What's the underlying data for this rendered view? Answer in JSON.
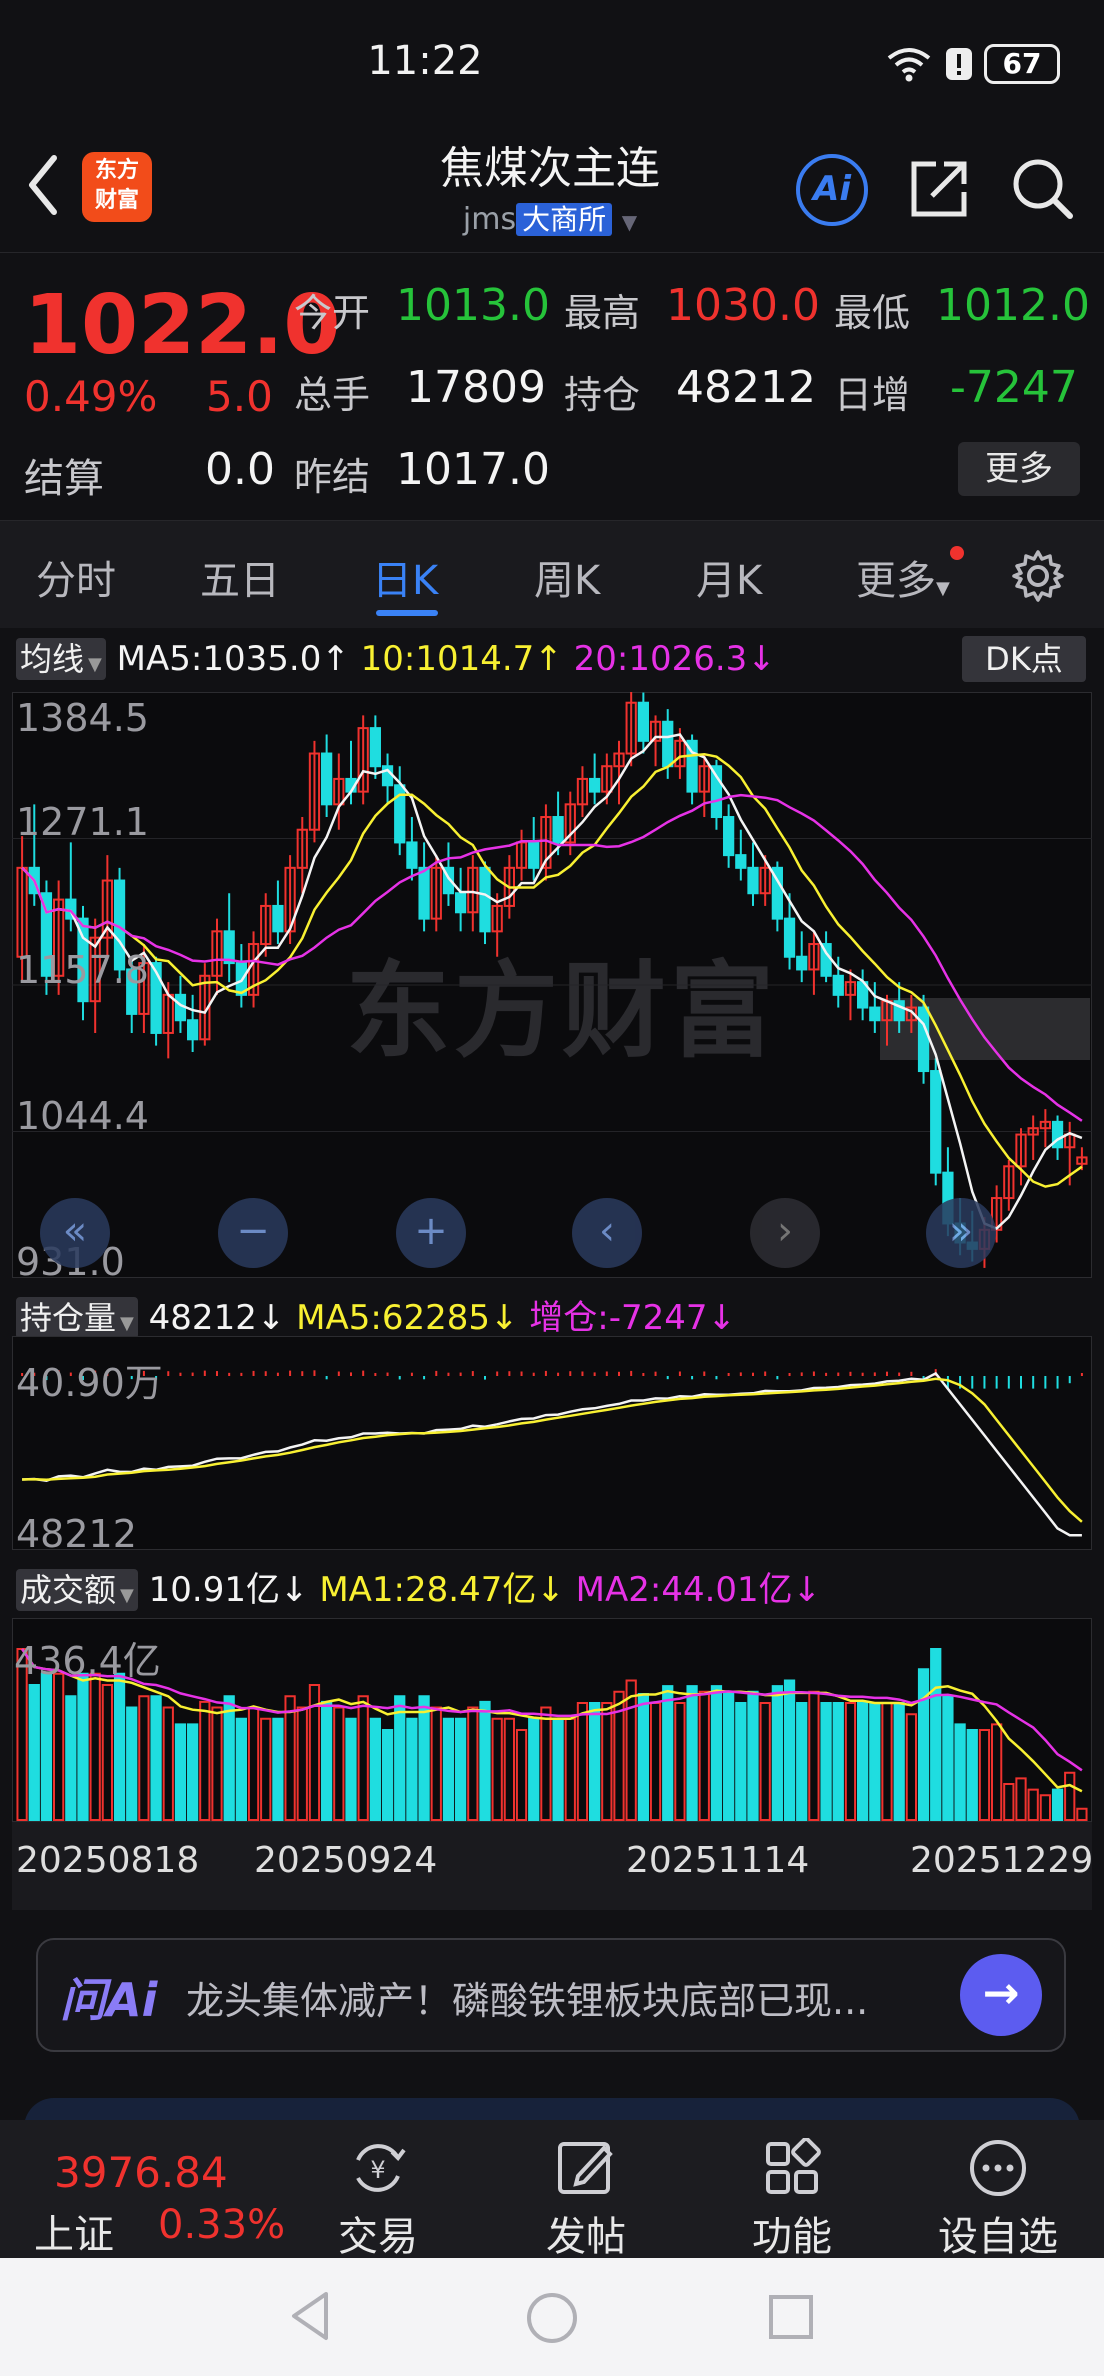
{
  "status": {
    "time": "11:22",
    "battery": "67"
  },
  "header": {
    "logo_line1": "东方",
    "logo_line2": "财富",
    "title": "焦煤次主连",
    "symbol": "jms",
    "exchange": "大商所"
  },
  "quote": {
    "price": "1022.0",
    "change_pct": "0.49%",
    "change": "5.0",
    "settle_label": "结算",
    "settle_value": "0.0",
    "fields": [
      {
        "label": "今开",
        "value": "1013.0",
        "color": "#26c33a"
      },
      {
        "label": "最高",
        "value": "1030.0",
        "color": "#f0322e"
      },
      {
        "label": "最低",
        "value": "1012.0",
        "color": "#26c33a"
      },
      {
        "label": "总手",
        "value": "17809",
        "color": "#f4f4f4"
      },
      {
        "label": "持仓",
        "value": "48212",
        "color": "#f4f4f4"
      },
      {
        "label": "日增",
        "value": "-7247",
        "color": "#26c33a"
      },
      {
        "label": "昨结",
        "value": "1017.0",
        "color": "#f4f4f4"
      }
    ],
    "more_label": "更多"
  },
  "tabs": [
    "分时",
    "五日",
    "日K",
    "周K",
    "月K",
    "更多"
  ],
  "kline": {
    "indicator_label": "均线",
    "ma5_text": "MA5:1035.0↑",
    "ma10_text": "10:1014.7↑",
    "ma20_text": "20:1026.3↓",
    "dk_label": "DK点",
    "watermark": "东方财富",
    "y_labels": [
      "1384.5",
      "1271.1",
      "1157.8",
      "1044.4",
      "931.0"
    ]
  },
  "oi": {
    "indicator_label": "持仓量",
    "value_text": "48212↓",
    "ma5_text": "MA5:62285↓",
    "inc_text": "增仓:-7247↓",
    "y_top": "40.90万",
    "y_bottom": "48212"
  },
  "turnover": {
    "indicator_label": "成交额",
    "value_text": "10.91亿↓",
    "ma1_text": "MA1:28.47亿↓",
    "ma2_text": "MA2:44.01亿↓",
    "y_top": "436.4亿"
  },
  "x_labels": [
    "20250818",
    "20250924",
    "20251114",
    "20251229"
  ],
  "ai_prompt": {
    "logo": "问Ai",
    "text": "龙头集体减产！磷酸铁锂板块底部已现..."
  },
  "bottom_nav": {
    "index_value": "3976.84",
    "index_name": "上证",
    "index_pct": "0.33%",
    "items": [
      "交易",
      "发帖",
      "功能",
      "设自选"
    ]
  },
  "colors": {
    "up": "#f0322e",
    "down": "#1fdde0",
    "ma5": "#f4f4f4",
    "ma10": "#f8f032",
    "ma20": "#e632e6",
    "accent": "#3a82f6"
  },
  "chart_data": {
    "type": "candlestick",
    "price_range": [
      931.0,
      1384.5
    ],
    "ohlc": [
      [
        1180,
        1275,
        1160,
        1250
      ],
      [
        1250,
        1300,
        1220,
        1230
      ],
      [
        1230,
        1240,
        1150,
        1165
      ],
      [
        1165,
        1240,
        1150,
        1225
      ],
      [
        1225,
        1270,
        1200,
        1210
      ],
      [
        1210,
        1220,
        1130,
        1145
      ],
      [
        1145,
        1210,
        1120,
        1195
      ],
      [
        1195,
        1260,
        1180,
        1240
      ],
      [
        1240,
        1250,
        1160,
        1170
      ],
      [
        1170,
        1180,
        1120,
        1135
      ],
      [
        1135,
        1190,
        1120,
        1175
      ],
      [
        1175,
        1180,
        1110,
        1120
      ],
      [
        1120,
        1160,
        1100,
        1150
      ],
      [
        1150,
        1165,
        1120,
        1130
      ],
      [
        1130,
        1150,
        1105,
        1115
      ],
      [
        1115,
        1175,
        1110,
        1165
      ],
      [
        1165,
        1210,
        1150,
        1200
      ],
      [
        1200,
        1230,
        1160,
        1175
      ],
      [
        1175,
        1190,
        1140,
        1150
      ],
      [
        1150,
        1200,
        1140,
        1190
      ],
      [
        1190,
        1230,
        1180,
        1220
      ],
      [
        1220,
        1240,
        1190,
        1200
      ],
      [
        1200,
        1260,
        1190,
        1250
      ],
      [
        1250,
        1290,
        1230,
        1280
      ],
      [
        1280,
        1350,
        1270,
        1340
      ],
      [
        1340,
        1355,
        1290,
        1300
      ],
      [
        1300,
        1340,
        1280,
        1320
      ],
      [
        1320,
        1350,
        1300,
        1310
      ],
      [
        1310,
        1370,
        1300,
        1360
      ],
      [
        1360,
        1370,
        1320,
        1330
      ],
      [
        1330,
        1340,
        1300,
        1315
      ],
      [
        1315,
        1330,
        1260,
        1270
      ],
      [
        1270,
        1290,
        1240,
        1250
      ],
      [
        1250,
        1270,
        1200,
        1210
      ],
      [
        1210,
        1260,
        1200,
        1250
      ],
      [
        1250,
        1270,
        1220,
        1230
      ],
      [
        1230,
        1250,
        1200,
        1215
      ],
      [
        1215,
        1260,
        1200,
        1250
      ],
      [
        1250,
        1255,
        1190,
        1200
      ],
      [
        1200,
        1230,
        1180,
        1220
      ],
      [
        1220,
        1260,
        1210,
        1250
      ],
      [
        1250,
        1280,
        1240,
        1270
      ],
      [
        1270,
        1290,
        1240,
        1250
      ],
      [
        1250,
        1300,
        1240,
        1290
      ],
      [
        1290,
        1310,
        1260,
        1270
      ],
      [
        1270,
        1310,
        1260,
        1300
      ],
      [
        1300,
        1330,
        1290,
        1320
      ],
      [
        1320,
        1340,
        1300,
        1310
      ],
      [
        1310,
        1340,
        1300,
        1330
      ],
      [
        1330,
        1350,
        1300,
        1340
      ],
      [
        1340,
        1390,
        1330,
        1380
      ],
      [
        1380,
        1388,
        1340,
        1350
      ],
      [
        1350,
        1370,
        1330,
        1365
      ],
      [
        1365,
        1375,
        1320,
        1330
      ],
      [
        1330,
        1360,
        1320,
        1350
      ],
      [
        1350,
        1355,
        1300,
        1310
      ],
      [
        1310,
        1340,
        1290,
        1330
      ],
      [
        1330,
        1335,
        1280,
        1290
      ],
      [
        1290,
        1300,
        1250,
        1260
      ],
      [
        1260,
        1280,
        1240,
        1250
      ],
      [
        1250,
        1270,
        1220,
        1230
      ],
      [
        1230,
        1260,
        1220,
        1250
      ],
      [
        1250,
        1255,
        1200,
        1210
      ],
      [
        1210,
        1230,
        1170,
        1180
      ],
      [
        1180,
        1200,
        1160,
        1170
      ],
      [
        1170,
        1200,
        1150,
        1190
      ],
      [
        1190,
        1200,
        1160,
        1165
      ],
      [
        1165,
        1180,
        1140,
        1150
      ],
      [
        1150,
        1170,
        1130,
        1160
      ],
      [
        1160,
        1170,
        1130,
        1140
      ],
      [
        1140,
        1160,
        1120,
        1130
      ],
      [
        1130,
        1150,
        1110,
        1145
      ],
      [
        1145,
        1160,
        1120,
        1130
      ],
      [
        1130,
        1150,
        1120,
        1140
      ],
      [
        1140,
        1150,
        1080,
        1090
      ],
      [
        1090,
        1100,
        1000,
        1010
      ],
      [
        1010,
        1030,
        960,
        970
      ],
      [
        970,
        990,
        945,
        955
      ],
      [
        955,
        980,
        940,
        950
      ],
      [
        950,
        975,
        935,
        965
      ],
      [
        965,
        1000,
        955,
        990
      ],
      [
        990,
        1020,
        980,
        1015
      ],
      [
        1015,
        1045,
        1000,
        1040
      ],
      [
        1040,
        1055,
        1020,
        1045
      ],
      [
        1045,
        1060,
        1030,
        1050
      ],
      [
        1050,
        1055,
        1020,
        1030
      ],
      [
        1030,
        1050,
        1000,
        1040
      ],
      [
        1017,
        1030,
        1012,
        1022
      ]
    ],
    "open_interest": {
      "current": 48212,
      "ma5": 62285,
      "change": -7247,
      "y_top_label": "40.90万"
    },
    "turnover": {
      "current_yi": 10.91,
      "ma1_yi": 28.47,
      "ma2_yi": 44.01,
      "y_max_yi": 436.4
    },
    "x_tick_labels": [
      "20250818",
      "20250924",
      "20251114",
      "20251229"
    ]
  }
}
